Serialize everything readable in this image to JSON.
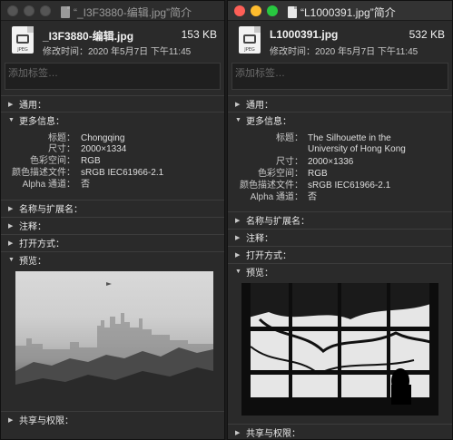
{
  "left": {
    "window_title": "“_I3F3880-编辑.jpg”简介",
    "file_name": "_I3F3880-编辑.jpg",
    "file_size": "153 KB",
    "modified": "修改时间：2020 年5月7日 下午11:45",
    "tags_placeholder": "添加标签…",
    "sections": {
      "general": "通用：",
      "more_info": "更多信息：",
      "name_ext": "名称与扩展名：",
      "comments": "注释：",
      "open_with": "打开方式：",
      "preview": "预览：",
      "sharing": "共享与权限："
    },
    "info": [
      {
        "k": "标题：",
        "v": "Chongqing"
      },
      {
        "k": "尺寸：",
        "v": "2000×1334"
      },
      {
        "k": "色彩空间：",
        "v": "RGB"
      },
      {
        "k": "颜色描述文件：",
        "v": "sRGB IEC61966-2.1"
      },
      {
        "k": "Alpha 通道：",
        "v": "否"
      }
    ]
  },
  "right": {
    "window_title": "“L1000391.jpg”简介",
    "file_name": "L1000391.jpg",
    "file_size": "532 KB",
    "modified": "修改时间：2020 年5月7日 下午11:45",
    "tags_placeholder": "添加标签…",
    "sections": {
      "general": "通用：",
      "more_info": "更多信息：",
      "name_ext": "名称与扩展名：",
      "comments": "注释：",
      "open_with": "打开方式：",
      "preview": "预览：",
      "sharing": "共享与权限："
    },
    "info": [
      {
        "k": "标题：",
        "v": "The Silhouette in the"
      },
      {
        "k": "",
        "v": "University of Hong Kong"
      },
      {
        "k": "尺寸：",
        "v": "2000×1336"
      },
      {
        "k": "色彩空间：",
        "v": "RGB"
      },
      {
        "k": "颜色描述文件：",
        "v": "sRGB IEC61966-2.1"
      },
      {
        "k": "Alpha 通道：",
        "v": "否"
      }
    ]
  },
  "icons": {
    "file_icon_ext": "JPEG",
    "expanded_arrow": "▼",
    "collapsed_arrow": "▶"
  },
  "colors": {
    "traffic_red": "#fe5f57",
    "traffic_yellow": "#febc2e",
    "traffic_green": "#28c840"
  }
}
